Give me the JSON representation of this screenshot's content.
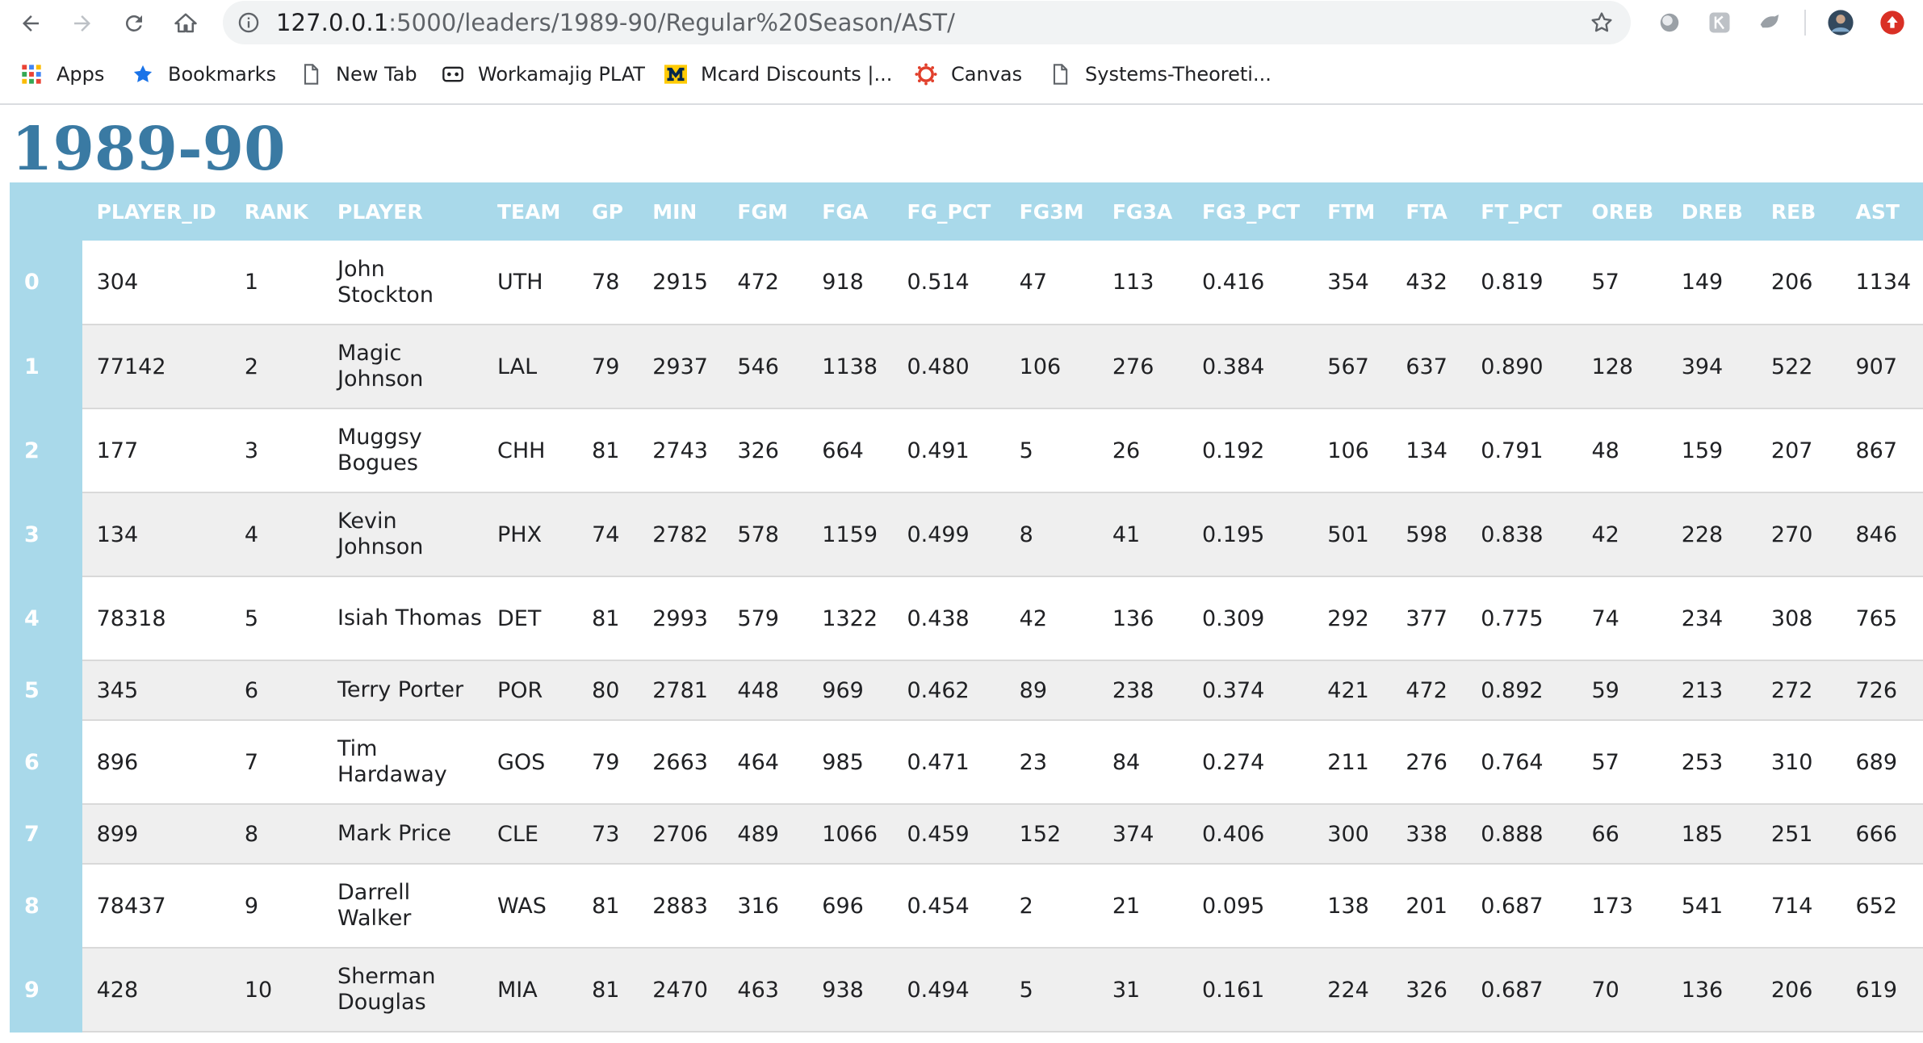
{
  "browser": {
    "url_host": "127.0.0.1",
    "url_path": ":5000/leaders/1989-90/Regular%20Season/AST/",
    "bookmarks": [
      {
        "label": "Apps",
        "icon": "apps-grid-icon"
      },
      {
        "label": "Bookmarks",
        "icon": "star-icon"
      },
      {
        "label": "New Tab",
        "icon": "page-icon"
      },
      {
        "label": "Workamajig PLAT",
        "icon": "workamajig-icon"
      },
      {
        "label": "Mcard Discounts |...",
        "icon": "michigan-m-icon"
      },
      {
        "label": "Canvas",
        "icon": "canvas-icon"
      },
      {
        "label": "Systems-Theoreti...",
        "icon": "page-icon"
      }
    ]
  },
  "page": {
    "title": "1989-90",
    "columns": [
      "",
      "PLAYER_ID",
      "RANK",
      "PLAYER",
      "TEAM",
      "GP",
      "MIN",
      "FGM",
      "FGA",
      "FG_PCT",
      "FG3M",
      "FG3A",
      "FG3_PCT",
      "FTM",
      "FTA",
      "FT_PCT",
      "OREB",
      "DREB",
      "REB",
      "AST"
    ],
    "rows": [
      [
        "0",
        "304",
        "1",
        "John Stockton",
        "UTH",
        "78",
        "2915",
        "472",
        "918",
        "0.514",
        "47",
        "113",
        "0.416",
        "354",
        "432",
        "0.819",
        "57",
        "149",
        "206",
        "1134"
      ],
      [
        "1",
        "77142",
        "2",
        "Magic Johnson",
        "LAL",
        "79",
        "2937",
        "546",
        "1138",
        "0.480",
        "106",
        "276",
        "0.384",
        "567",
        "637",
        "0.890",
        "128",
        "394",
        "522",
        "907"
      ],
      [
        "2",
        "177",
        "3",
        "Muggsy Bogues",
        "CHH",
        "81",
        "2743",
        "326",
        "664",
        "0.491",
        "5",
        "26",
        "0.192",
        "106",
        "134",
        "0.791",
        "48",
        "159",
        "207",
        "867"
      ],
      [
        "3",
        "134",
        "4",
        "Kevin Johnson",
        "PHX",
        "74",
        "2782",
        "578",
        "1159",
        "0.499",
        "8",
        "41",
        "0.195",
        "501",
        "598",
        "0.838",
        "42",
        "228",
        "270",
        "846"
      ],
      [
        "4",
        "78318",
        "5",
        "Isiah Thomas",
        "DET",
        "81",
        "2993",
        "579",
        "1322",
        "0.438",
        "42",
        "136",
        "0.309",
        "292",
        "377",
        "0.775",
        "74",
        "234",
        "308",
        "765"
      ],
      [
        "5",
        "345",
        "6",
        "Terry Porter",
        "POR",
        "80",
        "2781",
        "448",
        "969",
        "0.462",
        "89",
        "238",
        "0.374",
        "421",
        "472",
        "0.892",
        "59",
        "213",
        "272",
        "726"
      ],
      [
        "6",
        "896",
        "7",
        "Tim Hardaway",
        "GOS",
        "79",
        "2663",
        "464",
        "985",
        "0.471",
        "23",
        "84",
        "0.274",
        "211",
        "276",
        "0.764",
        "57",
        "253",
        "310",
        "689"
      ],
      [
        "7",
        "899",
        "8",
        "Mark Price",
        "CLE",
        "73",
        "2706",
        "489",
        "1066",
        "0.459",
        "152",
        "374",
        "0.406",
        "300",
        "338",
        "0.888",
        "66",
        "185",
        "251",
        "666"
      ],
      [
        "8",
        "78437",
        "9",
        "Darrell Walker",
        "WAS",
        "81",
        "2883",
        "316",
        "696",
        "0.454",
        "2",
        "21",
        "0.095",
        "138",
        "201",
        "0.687",
        "173",
        "541",
        "714",
        "652"
      ],
      [
        "9",
        "428",
        "10",
        "Sherman Douglas",
        "MIA",
        "81",
        "2470",
        "463",
        "938",
        "0.494",
        "5",
        "31",
        "0.161",
        "224",
        "326",
        "0.687",
        "70",
        "136",
        "206",
        "619"
      ]
    ]
  },
  "colors": {
    "title": "#3a7aa3",
    "header_bg": "#a9d9ea",
    "row_alt": "#efefef"
  }
}
